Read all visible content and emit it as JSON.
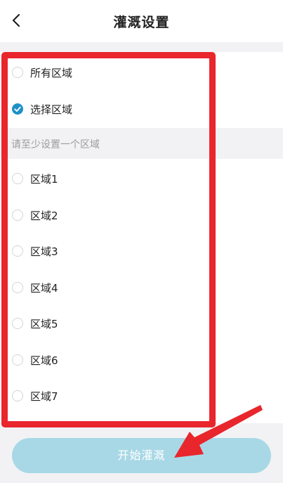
{
  "header": {
    "title": "灌溉设置",
    "back_icon": "chevron-left-icon"
  },
  "options": {
    "all_areas": {
      "label": "所有区域",
      "selected": false
    },
    "select_areas": {
      "label": "选择区域",
      "selected": true
    }
  },
  "hint": "请至少设置一个区域",
  "areas": [
    {
      "label": "区域1",
      "checked": false
    },
    {
      "label": "区域2",
      "checked": false
    },
    {
      "label": "区域3",
      "checked": false
    },
    {
      "label": "区域4",
      "checked": false
    },
    {
      "label": "区域5",
      "checked": false
    },
    {
      "label": "区域6",
      "checked": false
    },
    {
      "label": "区域7",
      "checked": false
    }
  ],
  "start_button": {
    "label": "开始灌溉",
    "enabled": false
  },
  "colors": {
    "accent": "#1e90c8",
    "button_disabled": "#a8d8e6",
    "annotation": "#e8262c"
  }
}
